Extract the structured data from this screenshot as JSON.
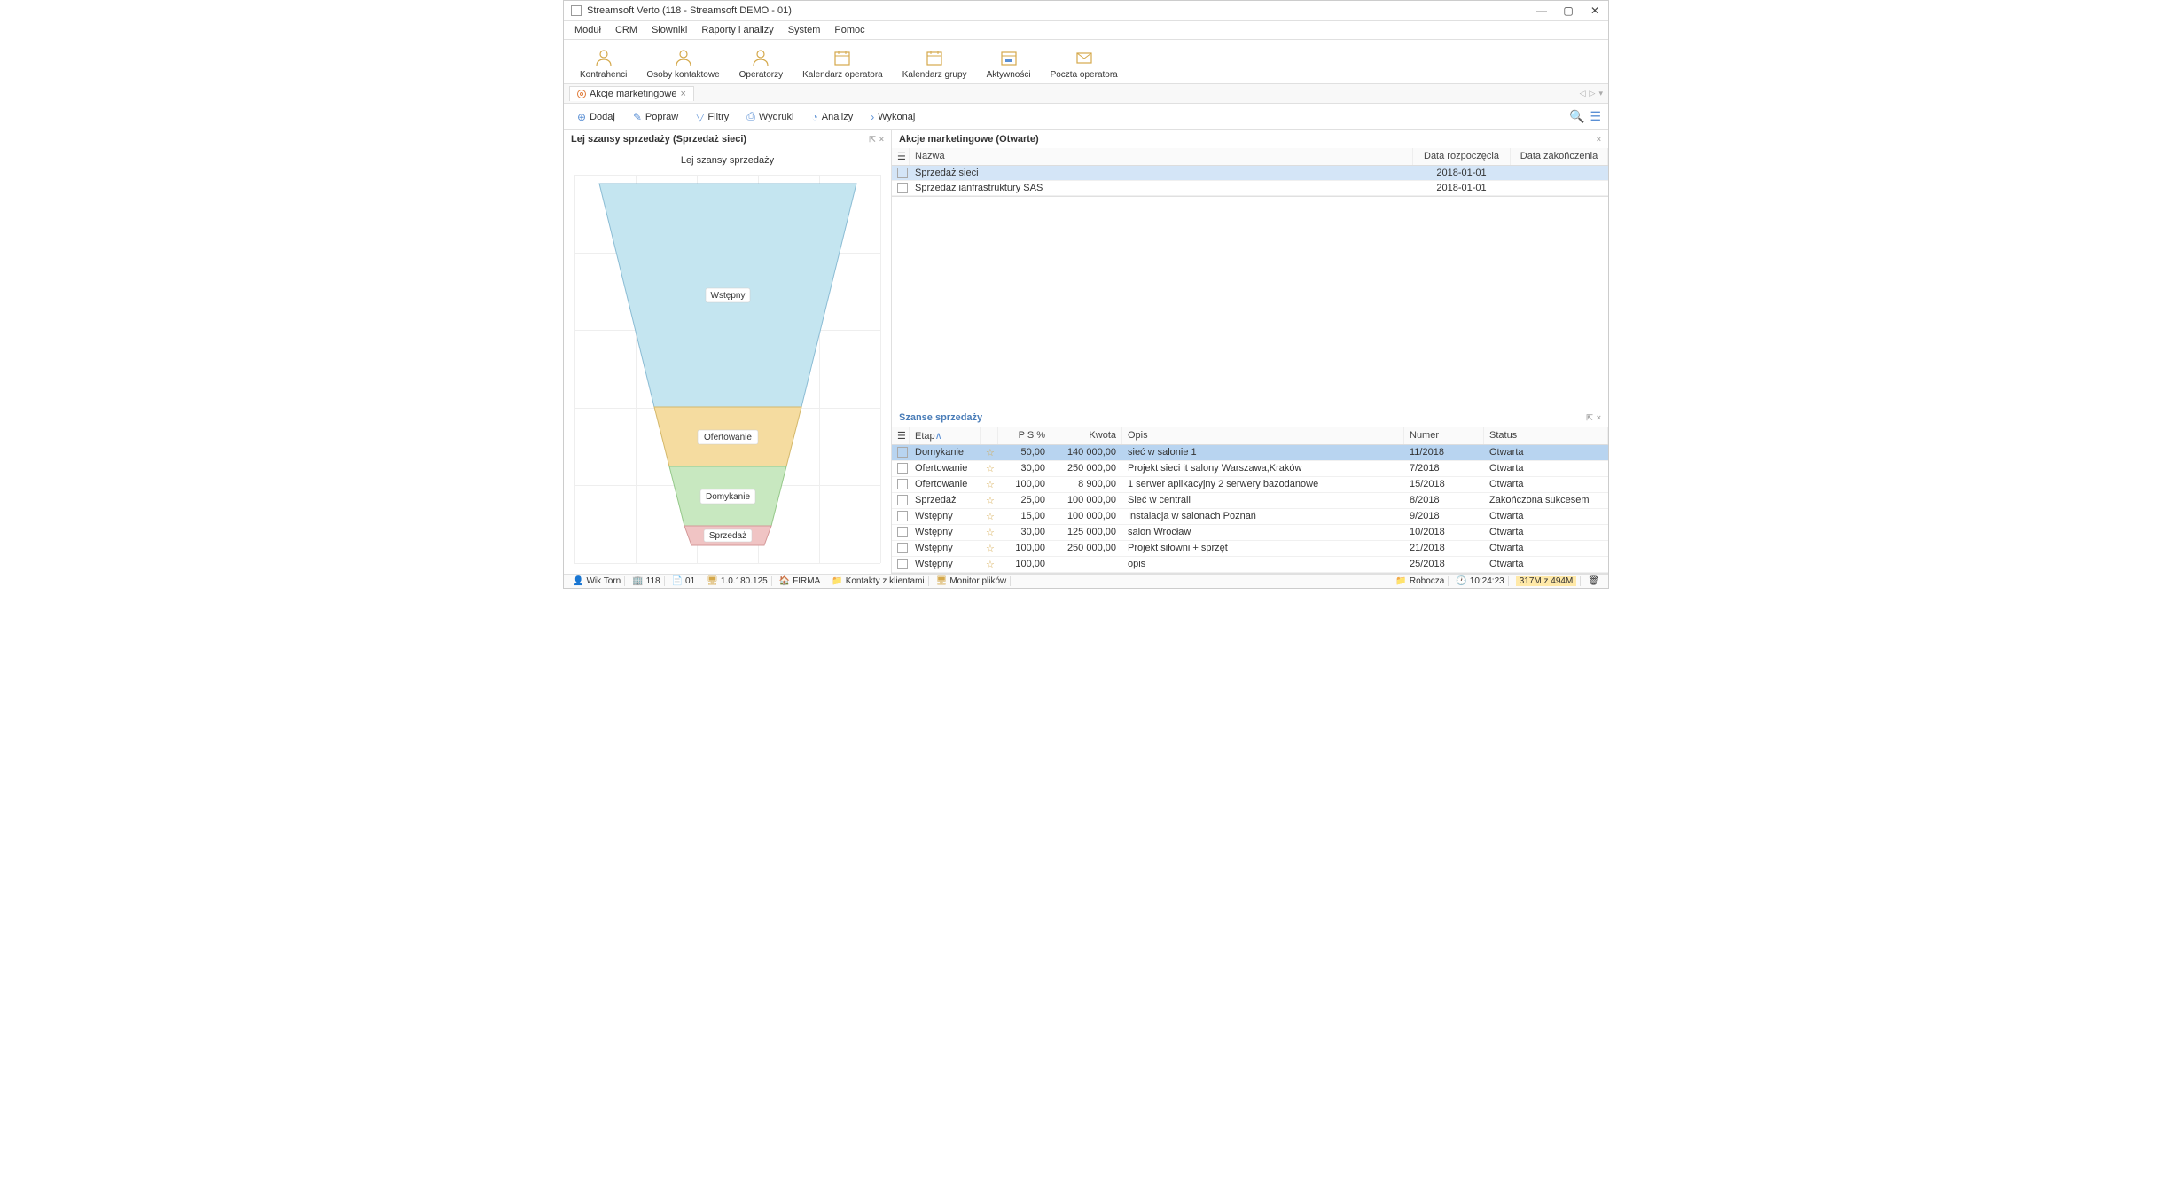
{
  "window": {
    "title": "Streamsoft Verto (118 - Streamsoft DEMO - 01)"
  },
  "menubar": [
    "Moduł",
    "CRM",
    "Słowniki",
    "Raporty i analizy",
    "System",
    "Pomoc"
  ],
  "ribbon": [
    {
      "label": "Kontrahenci",
      "icon": "person-icon"
    },
    {
      "label": "Osoby kontaktowe",
      "icon": "person-icon"
    },
    {
      "label": "Operatorzy",
      "icon": "person-icon"
    },
    {
      "label": "Kalendarz operatora",
      "icon": "calendar-icon"
    },
    {
      "label": "Kalendarz grupy",
      "icon": "calendar-icon"
    },
    {
      "label": "Aktywności",
      "icon": "calendar-list-icon"
    },
    {
      "label": "Poczta operatora",
      "icon": "mail-icon"
    }
  ],
  "tab": {
    "label": "Akcje marketingowe"
  },
  "toolbar": {
    "dodaj": "Dodaj",
    "popraw": "Popraw",
    "filtry": "Filtry",
    "wydruki": "Wydruki",
    "analizy": "Analizy",
    "wykonaj": "Wykonaj"
  },
  "left_panel": {
    "title": "Lej szansy sprzedaży (Sprzedaż sieci)",
    "chart_title": "Lej szansy sprzedaży"
  },
  "campaigns": {
    "title": "Akcje marketingowe (Otwarte)",
    "headers": {
      "nazwa": "Nazwa",
      "data_rozp": "Data rozpoczęcia",
      "data_zak": "Data zakończenia"
    },
    "rows": [
      {
        "nazwa": "Sprzedaż sieci",
        "data_rozp": "2018-01-01",
        "data_zak": "",
        "selected": true
      },
      {
        "nazwa": "Sprzedaż ianfrastruktury SAS",
        "data_rozp": "2018-01-01",
        "data_zak": "",
        "selected": false
      }
    ]
  },
  "opportunities": {
    "title": "Szanse sprzedaży",
    "headers": {
      "etap": "Etap",
      "ps": "P S %",
      "kwota": "Kwota",
      "opis": "Opis",
      "numer": "Numer",
      "status": "Status"
    },
    "rows": [
      {
        "etap": "Domykanie",
        "ps": "50,00",
        "kwota": "140 000,00",
        "opis": "sieć w salonie 1",
        "numer": "11/2018",
        "status": "Otwarta",
        "selected": true
      },
      {
        "etap": "Ofertowanie",
        "ps": "30,00",
        "kwota": "250 000,00",
        "opis": "Projekt sieci it salony Warszawa,Kraków",
        "numer": "7/2018",
        "status": "Otwarta"
      },
      {
        "etap": "Ofertowanie",
        "ps": "100,00",
        "kwota": "8 900,00",
        "opis": "1 serwer aplikacyjny 2 serwery bazodanowe",
        "numer": "15/2018",
        "status": "Otwarta"
      },
      {
        "etap": "Sprzedaż",
        "ps": "25,00",
        "kwota": "100 000,00",
        "opis": "Sieć w centrali",
        "numer": "8/2018",
        "status": "Zakończona sukcesem"
      },
      {
        "etap": "Wstępny",
        "ps": "15,00",
        "kwota": "100 000,00",
        "opis": "Instalacja w salonach Poznań",
        "numer": "9/2018",
        "status": "Otwarta"
      },
      {
        "etap": "Wstępny",
        "ps": "30,00",
        "kwota": "125 000,00",
        "opis": "salon Wrocław",
        "numer": "10/2018",
        "status": "Otwarta"
      },
      {
        "etap": "Wstępny",
        "ps": "100,00",
        "kwota": "250 000,00",
        "opis": "Projekt siłowni + sprzęt",
        "numer": "21/2018",
        "status": "Otwarta"
      },
      {
        "etap": "Wstępny",
        "ps": "100,00",
        "kwota": "",
        "opis": "opis",
        "numer": "25/2018",
        "status": "Otwarta"
      }
    ]
  },
  "statusbar": {
    "user": "Wik Torn",
    "num1": "118",
    "num2": "01",
    "ip": "1.0.180.125",
    "firma": "FIRMA",
    "kontakty": "Kontakty z klientami",
    "monitor": "Monitor plików",
    "robocza": "Robocza",
    "time": "10:24:23",
    "mem": "317M z 494M"
  },
  "chart_data": {
    "type": "funnel",
    "title": "Lej szansy sprzedaży",
    "stages": [
      {
        "label": "Wstępny",
        "color": "#c4e5f0",
        "height_ratio": 0.6
      },
      {
        "label": "Ofertowanie",
        "color": "#f5dca0",
        "height_ratio": 0.16
      },
      {
        "label": "Domykanie",
        "color": "#c8e8c0",
        "height_ratio": 0.16
      },
      {
        "label": "Sprzedaż",
        "color": "#f0c4c4",
        "height_ratio": 0.08
      }
    ]
  }
}
